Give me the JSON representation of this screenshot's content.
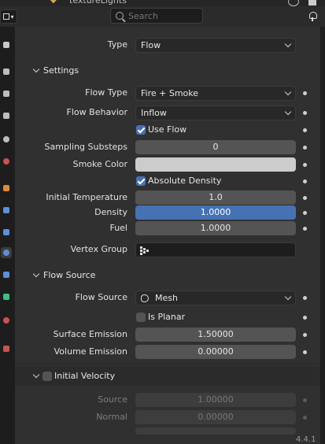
{
  "header": {
    "top_title": "textureLights",
    "search_placeholder": "Search"
  },
  "main": {
    "type": {
      "label": "Type",
      "value": "Flow"
    },
    "settings": {
      "title": "Settings",
      "flow_type": {
        "label": "Flow Type",
        "value": "Fire + Smoke"
      },
      "flow_behavior": {
        "label": "Flow Behavior",
        "value": "Inflow"
      },
      "use_flow": {
        "label": "Use Flow",
        "checked": true
      },
      "sampling_substeps": {
        "label": "Sampling Substeps",
        "value": "0"
      },
      "smoke_color": {
        "label": "Smoke Color",
        "color": "#cccccc"
      },
      "absolute_density": {
        "label": "Absolute Density",
        "checked": true
      },
      "initial_temperature": {
        "label": "Initial Temperature",
        "value": "1.0"
      },
      "density": {
        "label": "Density",
        "value": "1.0000"
      },
      "fuel": {
        "label": "Fuel",
        "value": "1.0000"
      },
      "vertex_group": {
        "label": "Vertex Group",
        "value": ""
      }
    },
    "flow_source_section": {
      "title": "Flow Source",
      "flow_source": {
        "label": "Flow Source",
        "value": "Mesh"
      },
      "is_planar": {
        "label": "Is Planar",
        "checked": false
      },
      "surface_emission": {
        "label": "Surface Emission",
        "value": "1.50000"
      },
      "volume_emission": {
        "label": "Volume Emission",
        "value": "0.00000"
      }
    },
    "initial_velocity": {
      "title": "Initial Velocity",
      "enabled": false,
      "source": {
        "label": "Source",
        "value": "1.00000"
      },
      "normal": {
        "label": "Normal",
        "value": "0.00000"
      }
    }
  },
  "status": {
    "text": "4.4.1"
  },
  "colors": {
    "accent": "#4672b4",
    "panel_bg": "#303030",
    "field_bg": "#545454"
  },
  "icons": [
    "search-icon",
    "pin-icon",
    "editor-type-icon",
    "mesh-icon",
    "vertex-group-icon"
  ]
}
